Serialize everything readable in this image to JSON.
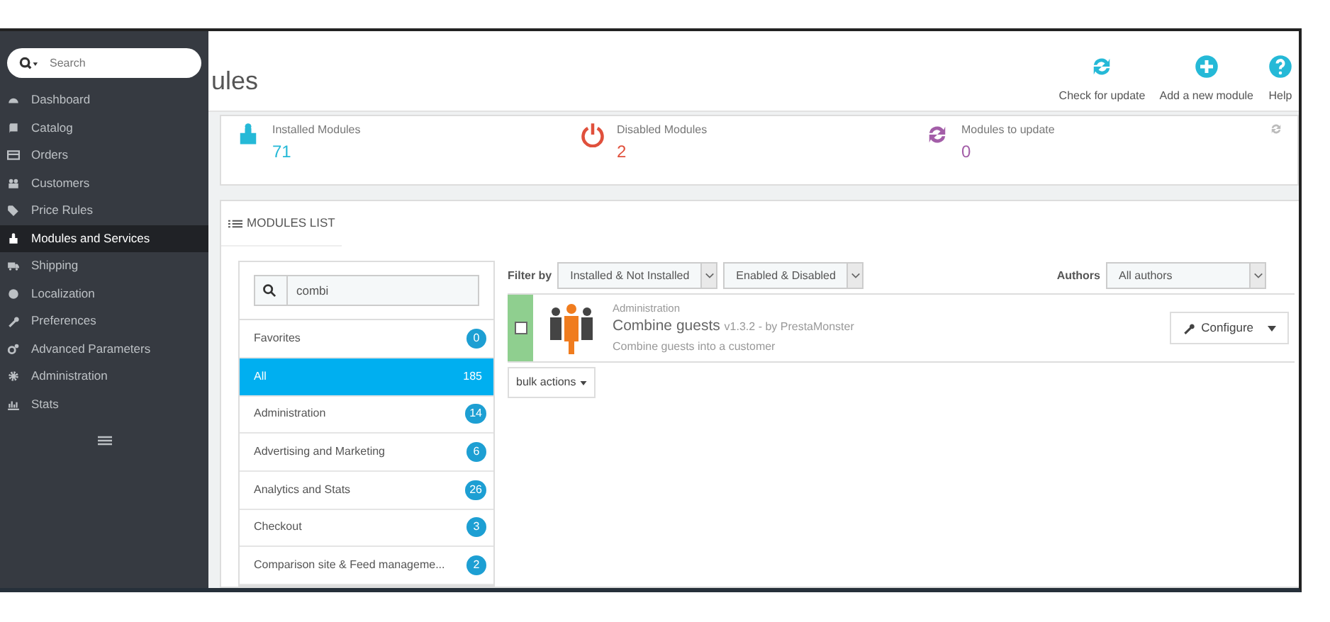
{
  "sidebar": {
    "search": {
      "placeholder": "Search"
    },
    "items": [
      {
        "label": "Dashboard",
        "selected": false
      },
      {
        "label": "Catalog",
        "selected": false
      },
      {
        "label": "Orders",
        "selected": false
      },
      {
        "label": "Customers",
        "selected": false
      },
      {
        "label": "Price Rules",
        "selected": false
      },
      {
        "label": "Modules and Services",
        "selected": true
      },
      {
        "label": "Shipping",
        "selected": false
      },
      {
        "label": "Localization",
        "selected": false
      },
      {
        "label": "Preferences",
        "selected": false
      },
      {
        "label": "Advanced Parameters",
        "selected": false
      },
      {
        "label": "Administration",
        "selected": false
      },
      {
        "label": "Stats",
        "selected": false
      }
    ]
  },
  "header": {
    "title": "ules",
    "actions": [
      {
        "label": "Check for update",
        "kind": "refresh"
      },
      {
        "label": "Add a new module",
        "kind": "plus"
      },
      {
        "label": "Help",
        "kind": "help"
      }
    ]
  },
  "stats": [
    {
      "label": "Installed Modules",
      "value": "71",
      "kind": "puzzle",
      "color": "#25b9d7"
    },
    {
      "label": "Disabled Modules",
      "value": "2",
      "kind": "power",
      "color": "#e0503c"
    },
    {
      "label": "Modules to update",
      "value": "0",
      "kind": "refresh",
      "color": "#a35ea8"
    }
  ],
  "modules_list": {
    "title": "MODULES LIST",
    "search": {
      "value": "combi"
    },
    "categories": [
      {
        "label": "Favorites",
        "count": "0",
        "selected": false
      },
      {
        "label": "All",
        "count": "185",
        "selected": true
      },
      {
        "label": "Administration",
        "count": "14",
        "selected": false
      },
      {
        "label": "Advertising and Marketing",
        "count": "6",
        "selected": false
      },
      {
        "label": "Analytics and Stats",
        "count": "26",
        "selected": false
      },
      {
        "label": "Checkout",
        "count": "3",
        "selected": false
      },
      {
        "label": "Comparison site & Feed manageme...",
        "count": "2",
        "selected": false
      }
    ],
    "filter_label": "Filter by",
    "filters": [
      "Installed & Not Installed",
      "Enabled & Disabled"
    ],
    "authors_label": "Authors",
    "authors": "All authors",
    "modules": [
      {
        "category": "Administration",
        "name": "Combine guests",
        "version": "v1.3.2 - by PrestaMonster",
        "description": "Combine guests into a customer",
        "checked": false,
        "installed": true,
        "action": "Configure"
      }
    ],
    "bulk_actions": "bulk actions"
  }
}
